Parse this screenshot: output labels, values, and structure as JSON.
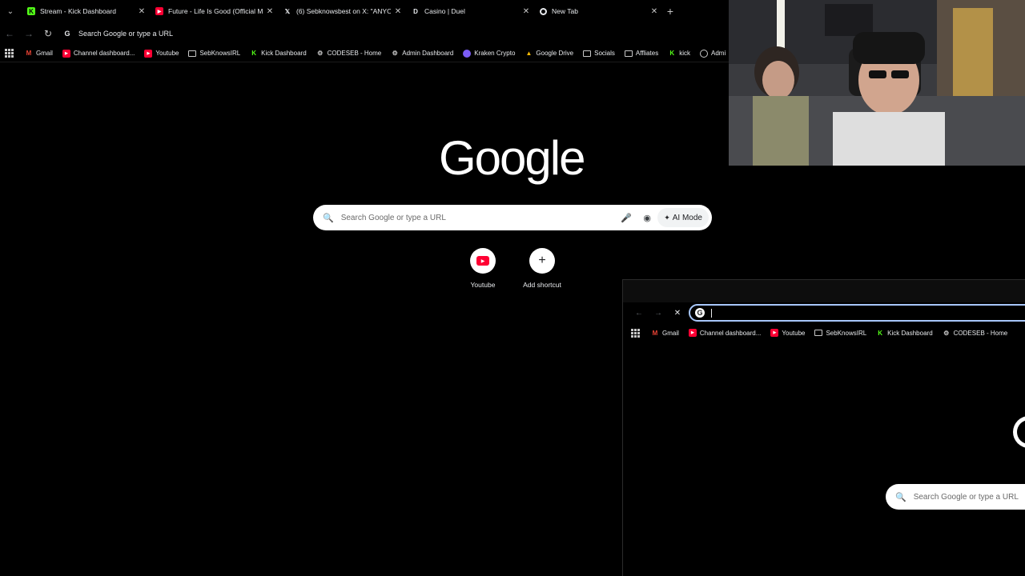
{
  "tabs": [
    {
      "title": "Stream - Kick Dashboard",
      "icon": "kick-icon",
      "color": "#53fc18"
    },
    {
      "title": "Future - Life Is Good (Official M",
      "icon": "youtube-icon",
      "color": "#ff0033"
    },
    {
      "title": "(6) Sebknowsbest on X: \"ANYO",
      "icon": "x-icon",
      "color": "#e8eaed"
    },
    {
      "title": "Casino | Duel",
      "icon": "duel-icon",
      "color": "#e8eaed"
    },
    {
      "title": "New Tab",
      "icon": "chrome-icon",
      "color": "#e8eaed"
    }
  ],
  "toolbar": {
    "omnibox_placeholder": "Search Google or type a URL"
  },
  "bookmarks": [
    {
      "label": "Gmail",
      "icon": "gmail-icon"
    },
    {
      "label": "Channel dashboard...",
      "icon": "youtube-icon"
    },
    {
      "label": "Youtube",
      "icon": "youtube-icon"
    },
    {
      "label": "SebKnowsIRL",
      "icon": "folder-icon"
    },
    {
      "label": "Kick Dashboard",
      "icon": "kick-icon"
    },
    {
      "label": "CODESEB - Home",
      "icon": "codeseb-icon"
    },
    {
      "label": "Admin Dashboard",
      "icon": "admin-icon"
    },
    {
      "label": "Kraken Crypto",
      "icon": "kraken-icon"
    },
    {
      "label": "Google Drive",
      "icon": "drive-icon"
    },
    {
      "label": "Socials",
      "icon": "folder-icon"
    },
    {
      "label": "Affliates",
      "icon": "folder-icon"
    },
    {
      "label": "kick",
      "icon": "kick-icon"
    },
    {
      "label": "Admi",
      "icon": "globe-icon"
    }
  ],
  "google": {
    "logo": "Google",
    "search_placeholder": "Search Google or type a URL",
    "ai_mode": "AI Mode"
  },
  "shortcuts": [
    {
      "label": "Youtube",
      "icon": "youtube-icon"
    },
    {
      "label": "Add shortcut",
      "icon": "plus-icon"
    }
  ],
  "nested": {
    "bookmarks": [
      {
        "label": "Gmail",
        "icon": "gmail-icon"
      },
      {
        "label": "Channel dashboard...",
        "icon": "youtube-icon"
      },
      {
        "label": "Youtube",
        "icon": "youtube-icon"
      },
      {
        "label": "SebKnowsIRL",
        "icon": "folder-icon"
      },
      {
        "label": "Kick Dashboard",
        "icon": "kick-icon"
      },
      {
        "label": "CODESEB - Home",
        "icon": "codeseb-icon"
      }
    ],
    "search_placeholder": "Search Google or type a URL"
  },
  "colors": {
    "kick": "#53fc18",
    "youtube": "#ff0033",
    "focus": "#a8c7fa"
  }
}
